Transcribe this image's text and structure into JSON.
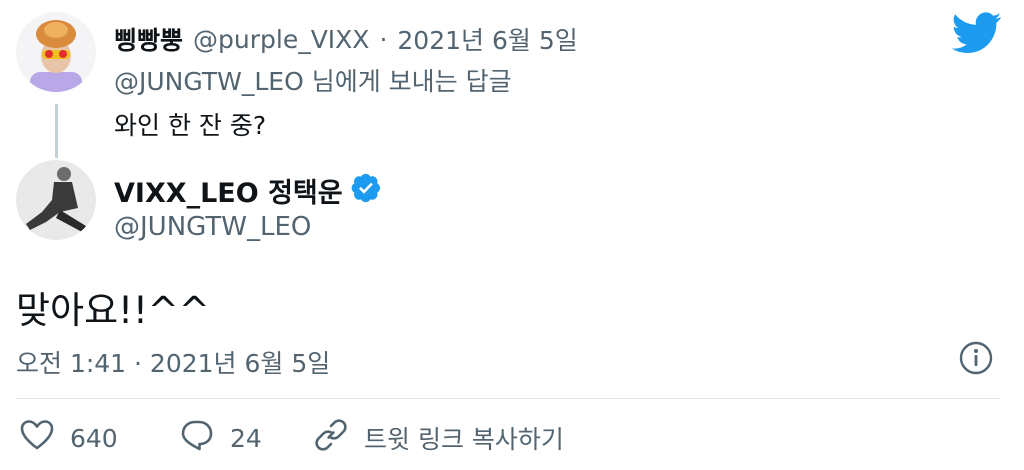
{
  "parent_tweet": {
    "display_name": "삥빵뿡",
    "handle": "@purple_VIXX",
    "separator": "·",
    "date": "2021년 6월 5일",
    "replying_to": "@JUNGTW_LEO 님에게 보내는 답글",
    "text": "와인 한 잔 중?"
  },
  "tweet": {
    "display_name": "VIXX_LEO 정택운",
    "handle": "@JUNGTW_LEO",
    "verified": true,
    "text": "맞아요!!^^",
    "timestamp": "오전 1:41 · 2021년 6월 5일"
  },
  "actions": {
    "like_count": "640",
    "reply_count": "24",
    "copy_link_label": "트윗 링크 복사하기"
  },
  "colors": {
    "twitter_blue": "#1d9bf0",
    "secondary_text": "#536471",
    "primary_text": "#0f1419",
    "thread_line": "#c4cfd6"
  },
  "icons": {
    "brand": "twitter-bird-icon",
    "verified": "verified-badge-icon",
    "info": "info-icon",
    "like": "heart-icon",
    "reply": "speech-bubble-icon",
    "copy_link": "link-icon"
  }
}
